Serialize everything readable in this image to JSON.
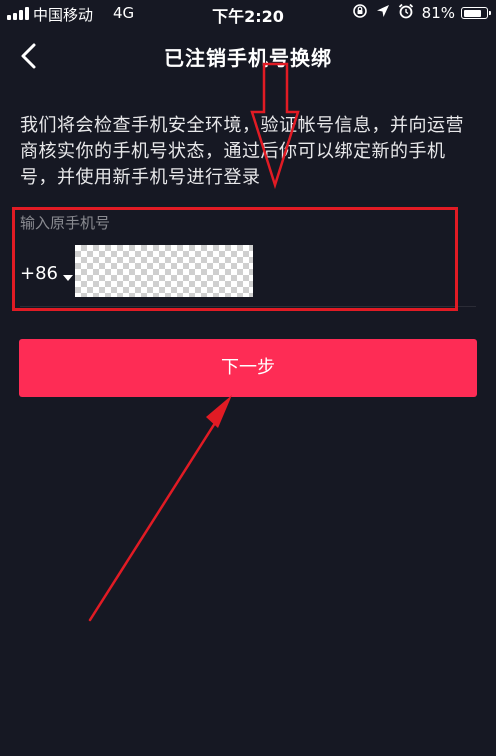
{
  "status_bar": {
    "carrier": "中国移动",
    "network": "4G",
    "time": "下午2:20",
    "battery_percent": "81%",
    "battery_level": 0.81,
    "icons": [
      "signal-icon",
      "orientation-lock-icon",
      "location-icon",
      "alarm-icon",
      "battery-icon"
    ]
  },
  "nav": {
    "back_icon": "chevron-left-icon",
    "title": "已注销手机号换绑"
  },
  "description": "我们将会检查手机安全环境，验证帐号信息，并向运营商核实你的手机号状态，通过后你可以绑定新的手机号，并使用新手机号进行登录",
  "phone_form": {
    "label": "输入原手机号",
    "country_code": "+86",
    "caret_icon": "caret-down-icon",
    "phone_value": ""
  },
  "next_button": {
    "label": "下一步"
  },
  "annotations": {
    "color": "#e11b24",
    "items": [
      "highlight-box",
      "down-arrow",
      "diagonal-arrow"
    ]
  },
  "colors": {
    "background": "#161823",
    "accent": "#fe2c55",
    "label": "#8a8b91",
    "annotation": "#e11b24"
  }
}
